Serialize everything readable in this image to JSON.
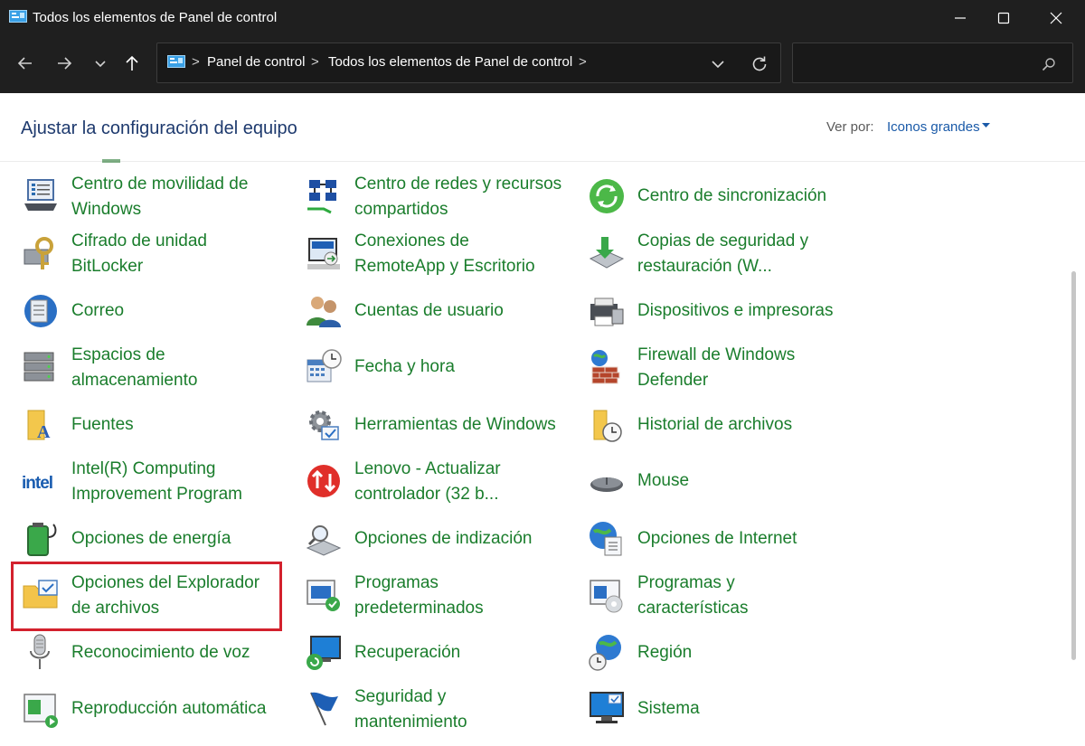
{
  "window": {
    "title": "Todos los elementos de Panel de control"
  },
  "address_bar": {
    "crumbs": [
      "Panel de control",
      "Todos los elementos de Panel de control"
    ],
    "separator": ">",
    "search_placeholder": ""
  },
  "header": {
    "title": "Ajustar la configuración del equipo",
    "view_by_label": "Ver por:",
    "view_by_value": "Iconos grandes"
  },
  "colors": {
    "titlebar_bg": "#1f1f1f",
    "link_green": "#1a7d2c",
    "header_blue": "#1e3a6e",
    "highlight_red": "#d3212d"
  },
  "items": [
    {
      "line1": "Centro de movilidad de",
      "line2": "Windows",
      "icon": "mobility-center-icon"
    },
    {
      "line1": "Centro de redes y recursos",
      "line2": "compartidos",
      "icon": "network-center-icon"
    },
    {
      "line1": "Centro de sincronización",
      "line2": "",
      "icon": "sync-center-icon"
    },
    {
      "line1": "Cifrado de unidad",
      "line2": "BitLocker",
      "icon": "bitlocker-icon"
    },
    {
      "line1": "Conexiones de",
      "line2": "RemoteApp y Escritorio",
      "icon": "remoteapp-icon"
    },
    {
      "line1": "Copias de seguridad y",
      "line2": "restauración (W...",
      "icon": "backup-icon"
    },
    {
      "line1": "Correo",
      "line2": "",
      "icon": "mail-icon"
    },
    {
      "line1": "Cuentas de usuario",
      "line2": "",
      "icon": "user-accounts-icon"
    },
    {
      "line1": "Dispositivos e impresoras",
      "line2": "",
      "icon": "devices-printers-icon"
    },
    {
      "line1": "Espacios de",
      "line2": "almacenamiento",
      "icon": "storage-spaces-icon"
    },
    {
      "line1": "Fecha y hora",
      "line2": "",
      "icon": "date-time-icon"
    },
    {
      "line1": "Firewall de Windows",
      "line2": "Defender",
      "icon": "firewall-icon"
    },
    {
      "line1": "Fuentes",
      "line2": "",
      "icon": "fonts-icon"
    },
    {
      "line1": "Herramientas de Windows",
      "line2": "",
      "icon": "windows-tools-icon"
    },
    {
      "line1": "Historial de archivos",
      "line2": "",
      "icon": "file-history-icon"
    },
    {
      "line1": "Intel(R) Computing",
      "line2": "Improvement Program",
      "icon": "intel-icon"
    },
    {
      "line1": "Lenovo - Actualizar",
      "line2": "controlador (32 b...",
      "icon": "lenovo-update-icon"
    },
    {
      "line1": "Mouse",
      "line2": "",
      "icon": "mouse-icon"
    },
    {
      "line1": "Opciones de energía",
      "line2": "",
      "icon": "power-options-icon"
    },
    {
      "line1": "Opciones de indización",
      "line2": "",
      "icon": "indexing-icon"
    },
    {
      "line1": "Opciones de Internet",
      "line2": "",
      "icon": "internet-options-icon"
    },
    {
      "line1": "Opciones del Explorador",
      "line2": "de archivos",
      "icon": "file-explorer-options-icon"
    },
    {
      "line1": "Programas",
      "line2": "predeterminados",
      "icon": "default-programs-icon"
    },
    {
      "line1": "Programas y",
      "line2": "características",
      "icon": "programs-features-icon"
    },
    {
      "line1": "Reconocimiento de voz",
      "line2": "",
      "icon": "speech-recognition-icon"
    },
    {
      "line1": "Recuperación",
      "line2": "",
      "icon": "recovery-icon"
    },
    {
      "line1": "Región",
      "line2": "",
      "icon": "region-icon"
    },
    {
      "line1": "Reproducción automática",
      "line2": "",
      "icon": "autoplay-icon"
    },
    {
      "line1": "Seguridad y",
      "line2": "mantenimiento",
      "icon": "security-maintenance-icon"
    },
    {
      "line1": "Sistema",
      "line2": "",
      "icon": "system-icon"
    }
  ]
}
